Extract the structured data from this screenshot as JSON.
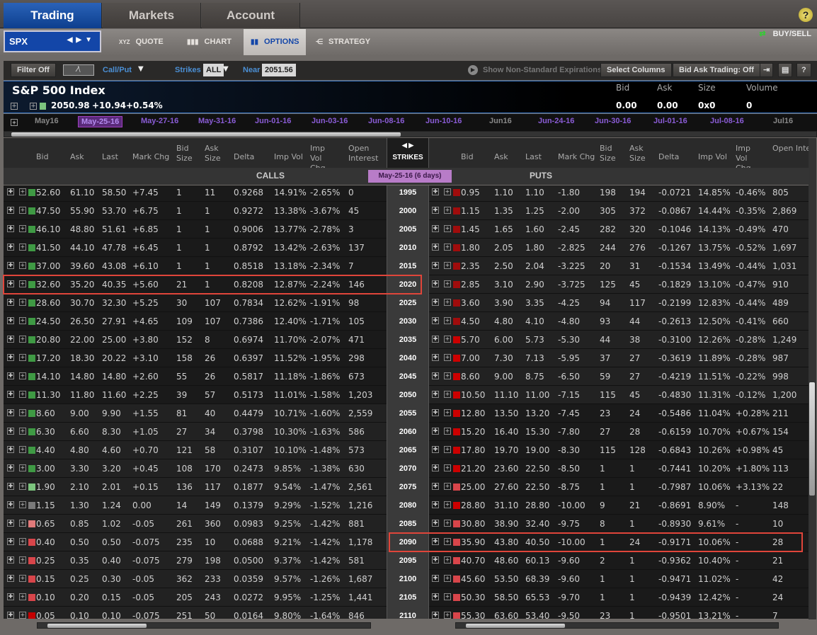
{
  "nav": {
    "tabs": [
      "Trading",
      "Markets",
      "Account"
    ],
    "help": "?"
  },
  "subnav": {
    "symbol": "SPX",
    "tabs": [
      {
        "icon_text": "XYZ",
        "label": "QUOTE"
      },
      {
        "label": "CHART"
      },
      {
        "label": "OPTIONS"
      },
      {
        "label": "STRATEGY"
      }
    ],
    "buy_sell": "BUY/SELL"
  },
  "toolbar": {
    "filter": "Filter Off",
    "callput": "Call/Put",
    "strikes_label": "Strikes",
    "strikes_value": "ALL",
    "near_label": "Near",
    "near_value": "2051.56",
    "nonstandard": "Show Non-Standard Expirations",
    "select_columns": "Select Columns",
    "bid_ask_trading": "Bid Ask Trading: Off",
    "help": "?"
  },
  "quote": {
    "name": "S&P 500 Index",
    "last": "2050.98",
    "change": "+10.94",
    "pct": "+0.54%",
    "labels": [
      "Bid",
      "Ask",
      "Size",
      "Volume"
    ],
    "values": [
      "0.00",
      "0.00",
      "0x0",
      "0"
    ]
  },
  "expirations": [
    {
      "label": "May16",
      "type": "monthly"
    },
    {
      "label": "May-25-16",
      "type": "selected"
    },
    {
      "label": "May-27-16"
    },
    {
      "label": "May-31-16"
    },
    {
      "label": "Jun-01-16"
    },
    {
      "label": "Jun-03-16"
    },
    {
      "label": "Jun-08-16"
    },
    {
      "label": "Jun-10-16"
    },
    {
      "label": "Jun16",
      "type": "monthly"
    },
    {
      "label": "Jun-24-16"
    },
    {
      "label": "Jun-30-16"
    },
    {
      "label": "Jul-01-16"
    },
    {
      "label": "Jul-08-16"
    },
    {
      "label": "Jul16",
      "type": "monthly"
    }
  ],
  "columns": {
    "calls": [
      "Bid",
      "Ask",
      "Last",
      "Mark Chg",
      "Bid Size",
      "Ask Size",
      "Delta",
      "Imp Vol",
      "Imp Vol Chg",
      "Open Interest"
    ],
    "puts": [
      "Bid",
      "Ask",
      "Last",
      "Mark Chg",
      "Bid Size",
      "Ask Size",
      "Delta",
      "Imp Vol",
      "Imp Vol Chg",
      "Open Inte"
    ],
    "strikes": "STRIKES"
  },
  "sections": {
    "calls": "CALLS",
    "puts": "PUTS",
    "expiry": "May-25-16",
    "days": "(6 days)"
  },
  "colors": {
    "green": "#3f9a44",
    "lightgreen": "#7cc47e",
    "grey": "#7a7a7a",
    "pink": "#e07a7a",
    "red": "#d8454a",
    "deepred": "#c30000",
    "darkred": "#a00c0c",
    "brightred": "#cc0000",
    "highlight": "#e0453a"
  },
  "rows": [
    {
      "strike": "2095",
      "x": 0
    },
    {
      "strike": "1995",
      "c": [
        "52.60",
        "61.10",
        "58.50",
        "+7.45",
        "1",
        "11",
        "0.9268",
        "14.91%",
        "-2.65%",
        "0"
      ],
      "ci": "green",
      "p": [
        "0.95",
        "1.10",
        "1.10",
        "-1.80",
        "198",
        "194",
        "-0.0721",
        "14.85%",
        "-0.46%",
        "805"
      ],
      "pi": "darkred"
    },
    {
      "strike": "2000",
      "c": [
        "47.50",
        "55.90",
        "53.70",
        "+6.75",
        "1",
        "1",
        "0.9272",
        "13.38%",
        "-3.67%",
        "45"
      ],
      "ci": "green",
      "p": [
        "1.15",
        "1.35",
        "1.25",
        "-2.00",
        "305",
        "372",
        "-0.0867",
        "14.44%",
        "-0.35%",
        "2,869"
      ],
      "pi": "darkred"
    },
    {
      "strike": "2005",
      "c": [
        "46.10",
        "48.80",
        "51.61",
        "+6.85",
        "1",
        "1",
        "0.9006",
        "13.77%",
        "-2.78%",
        "3"
      ],
      "ci": "green",
      "p": [
        "1.45",
        "1.65",
        "1.60",
        "-2.45",
        "282",
        "320",
        "-0.1046",
        "14.13%",
        "-0.49%",
        "470"
      ],
      "pi": "darkred"
    },
    {
      "strike": "2010",
      "c": [
        "41.50",
        "44.10",
        "47.78",
        "+6.45",
        "1",
        "1",
        "0.8792",
        "13.42%",
        "-2.63%",
        "137"
      ],
      "ci": "green",
      "p": [
        "1.80",
        "2.05",
        "1.80",
        "-2.825",
        "244",
        "276",
        "-0.1267",
        "13.75%",
        "-0.52%",
        "1,697"
      ],
      "pi": "darkred"
    },
    {
      "strike": "2015",
      "c": [
        "37.00",
        "39.60",
        "43.08",
        "+6.10",
        "1",
        "1",
        "0.8518",
        "13.18%",
        "-2.34%",
        "7"
      ],
      "ci": "green",
      "p": [
        "2.35",
        "2.50",
        "2.04",
        "-3.225",
        "20",
        "31",
        "-0.1534",
        "13.49%",
        "-0.44%",
        "1,031"
      ],
      "pi": "darkred"
    },
    {
      "strike": "2020",
      "c": [
        "32.60",
        "35.20",
        "40.35",
        "+5.60",
        "21",
        "1",
        "0.8208",
        "12.87%",
        "-2.24%",
        "146"
      ],
      "ci": "green",
      "p": [
        "2.85",
        "3.10",
        "2.90",
        "-3.725",
        "125",
        "45",
        "-0.1829",
        "13.10%",
        "-0.47%",
        "910"
      ],
      "pi": "darkred",
      "highlight": "calls"
    },
    {
      "strike": "2025",
      "c": [
        "28.60",
        "30.70",
        "32.30",
        "+5.25",
        "30",
        "107",
        "0.7834",
        "12.62%",
        "-1.91%",
        "98"
      ],
      "ci": "green",
      "p": [
        "3.60",
        "3.90",
        "3.35",
        "-4.25",
        "94",
        "117",
        "-0.2199",
        "12.83%",
        "-0.44%",
        "489"
      ],
      "pi": "darkred"
    },
    {
      "strike": "2030",
      "c": [
        "24.50",
        "26.50",
        "27.91",
        "+4.65",
        "109",
        "107",
        "0.7386",
        "12.40%",
        "-1.71%",
        "105"
      ],
      "ci": "green",
      "p": [
        "4.50",
        "4.80",
        "4.10",
        "-4.80",
        "93",
        "44",
        "-0.2613",
        "12.50%",
        "-0.41%",
        "660"
      ],
      "pi": "darkred"
    },
    {
      "strike": "2035",
      "c": [
        "20.80",
        "22.00",
        "25.00",
        "+3.80",
        "152",
        "8",
        "0.6974",
        "11.70%",
        "-2.07%",
        "471"
      ],
      "ci": "green",
      "p": [
        "5.70",
        "6.00",
        "5.73",
        "-5.30",
        "44",
        "38",
        "-0.3100",
        "12.26%",
        "-0.28%",
        "1,249"
      ],
      "pi": "brightred"
    },
    {
      "strike": "2040",
      "c": [
        "17.20",
        "18.30",
        "20.22",
        "+3.10",
        "158",
        "26",
        "0.6397",
        "11.52%",
        "-1.95%",
        "298"
      ],
      "ci": "green",
      "p": [
        "7.00",
        "7.30",
        "7.13",
        "-5.95",
        "37",
        "27",
        "-0.3619",
        "11.89%",
        "-0.28%",
        "987"
      ],
      "pi": "brightred"
    },
    {
      "strike": "2045",
      "c": [
        "14.10",
        "14.80",
        "14.80",
        "+2.60",
        "55",
        "26",
        "0.5817",
        "11.18%",
        "-1.86%",
        "673"
      ],
      "ci": "green",
      "p": [
        "8.60",
        "9.00",
        "8.75",
        "-6.50",
        "59",
        "27",
        "-0.4219",
        "11.51%",
        "-0.22%",
        "998"
      ],
      "pi": "brightred"
    },
    {
      "strike": "2050",
      "c": [
        "11.30",
        "11.80",
        "11.60",
        "+2.25",
        "39",
        "57",
        "0.5173",
        "11.01%",
        "-1.58%",
        "1,203"
      ],
      "ci": "green",
      "p": [
        "10.50",
        "11.10",
        "11.00",
        "-7.15",
        "115",
        "45",
        "-0.4830",
        "11.31%",
        "-0.12%",
        "1,200"
      ],
      "pi": "brightred"
    },
    {
      "strike": "2055",
      "c": [
        "8.60",
        "9.00",
        "9.90",
        "+1.55",
        "81",
        "40",
        "0.4479",
        "10.71%",
        "-1.60%",
        "2,559"
      ],
      "ci": "green",
      "p": [
        "12.80",
        "13.50",
        "13.20",
        "-7.45",
        "23",
        "24",
        "-0.5486",
        "11.04%",
        "+0.28%",
        "211"
      ],
      "pi": "brightred"
    },
    {
      "strike": "2060",
      "c": [
        "6.30",
        "6.60",
        "8.30",
        "+1.05",
        "27",
        "34",
        "0.3798",
        "10.30%",
        "-1.63%",
        "586"
      ],
      "ci": "green",
      "p": [
        "15.20",
        "16.40",
        "15.30",
        "-7.80",
        "27",
        "28",
        "-0.6159",
        "10.70%",
        "+0.67%",
        "154"
      ],
      "pi": "brightred"
    },
    {
      "strike": "2065",
      "c": [
        "4.40",
        "4.80",
        "4.60",
        "+0.70",
        "121",
        "58",
        "0.3107",
        "10.10%",
        "-1.48%",
        "573"
      ],
      "ci": "green",
      "p": [
        "17.80",
        "19.70",
        "19.00",
        "-8.30",
        "115",
        "128",
        "-0.6843",
        "10.26%",
        "+0.98%",
        "45"
      ],
      "pi": "brightred"
    },
    {
      "strike": "2070",
      "c": [
        "3.00",
        "3.30",
        "3.20",
        "+0.45",
        "108",
        "170",
        "0.2473",
        "9.85%",
        "-1.38%",
        "630"
      ],
      "ci": "green",
      "p": [
        "21.20",
        "23.60",
        "22.50",
        "-8.50",
        "1",
        "1",
        "-0.7441",
        "10.20%",
        "+1.80%",
        "113"
      ],
      "pi": "brightred"
    },
    {
      "strike": "2075",
      "c": [
        "1.90",
        "2.10",
        "2.01",
        "+0.15",
        "136",
        "117",
        "0.1877",
        "9.54%",
        "-1.47%",
        "2,561"
      ],
      "ci": "lightgreen",
      "p": [
        "25.00",
        "27.60",
        "22.50",
        "-8.75",
        "1",
        "1",
        "-0.7987",
        "10.06%",
        "+3.13%",
        "22"
      ],
      "pi": "red"
    },
    {
      "strike": "2080",
      "c": [
        "1.15",
        "1.30",
        "1.24",
        "0.00",
        "14",
        "149",
        "0.1379",
        "9.29%",
        "-1.52%",
        "1,216"
      ],
      "ci": "grey",
      "p": [
        "28.80",
        "31.10",
        "28.80",
        "-10.00",
        "9",
        "21",
        "-0.8691",
        "8.90%",
        "-",
        "148"
      ],
      "pi": "brightred"
    },
    {
      "strike": "2085",
      "c": [
        "0.65",
        "0.85",
        "1.02",
        "-0.05",
        "261",
        "360",
        "0.0983",
        "9.25%",
        "-1.42%",
        "881"
      ],
      "ci": "pink",
      "p": [
        "30.80",
        "38.90",
        "32.40",
        "-9.75",
        "8",
        "1",
        "-0.8930",
        "9.61%",
        "-",
        "10"
      ],
      "pi": "red"
    },
    {
      "strike": "2090",
      "c": [
        "0.40",
        "0.50",
        "0.50",
        "-0.075",
        "235",
        "10",
        "0.0688",
        "9.21%",
        "-1.42%",
        "1,178"
      ],
      "ci": "red",
      "p": [
        "35.90",
        "43.80",
        "40.50",
        "-10.00",
        "1",
        "24",
        "-0.9171",
        "10.06%",
        "-",
        "28"
      ],
      "pi": "red",
      "highlight": "puts"
    },
    {
      "strike": "2095",
      "c": [
        "0.25",
        "0.35",
        "0.40",
        "-0.075",
        "279",
        "198",
        "0.0500",
        "9.37%",
        "-1.42%",
        "581"
      ],
      "ci": "red",
      "p": [
        "40.70",
        "48.60",
        "60.13",
        "-9.60",
        "2",
        "1",
        "-0.9362",
        "10.40%",
        "-",
        "21"
      ],
      "pi": "red"
    },
    {
      "strike": "2100",
      "c": [
        "0.15",
        "0.25",
        "0.30",
        "-0.05",
        "362",
        "233",
        "0.0359",
        "9.57%",
        "-1.26%",
        "1,687"
      ],
      "ci": "red",
      "p": [
        "45.60",
        "53.50",
        "68.39",
        "-9.60",
        "1",
        "1",
        "-0.9471",
        "11.02%",
        "-",
        "42"
      ],
      "pi": "red"
    },
    {
      "strike": "2105",
      "c": [
        "0.10",
        "0.20",
        "0.15",
        "-0.05",
        "205",
        "243",
        "0.0272",
        "9.95%",
        "-1.25%",
        "1,441"
      ],
      "ci": "red",
      "p": [
        "50.30",
        "58.50",
        "65.53",
        "-9.70",
        "1",
        "1",
        "-0.9439",
        "12.42%",
        "-",
        "24"
      ],
      "pi": "red"
    },
    {
      "strike": "2110",
      "c": [
        "0.05",
        "0.10",
        "0.10",
        "-0.075",
        "251",
        "50",
        "0.0164",
        "9.80%",
        "-1.64%",
        "846"
      ],
      "ci": "deepred",
      "p": [
        "55.30",
        "63.60",
        "53.40",
        "-9.50",
        "23",
        "1",
        "-0.9501",
        "13.21%",
        "-",
        "7"
      ],
      "pi": "red"
    }
  ]
}
